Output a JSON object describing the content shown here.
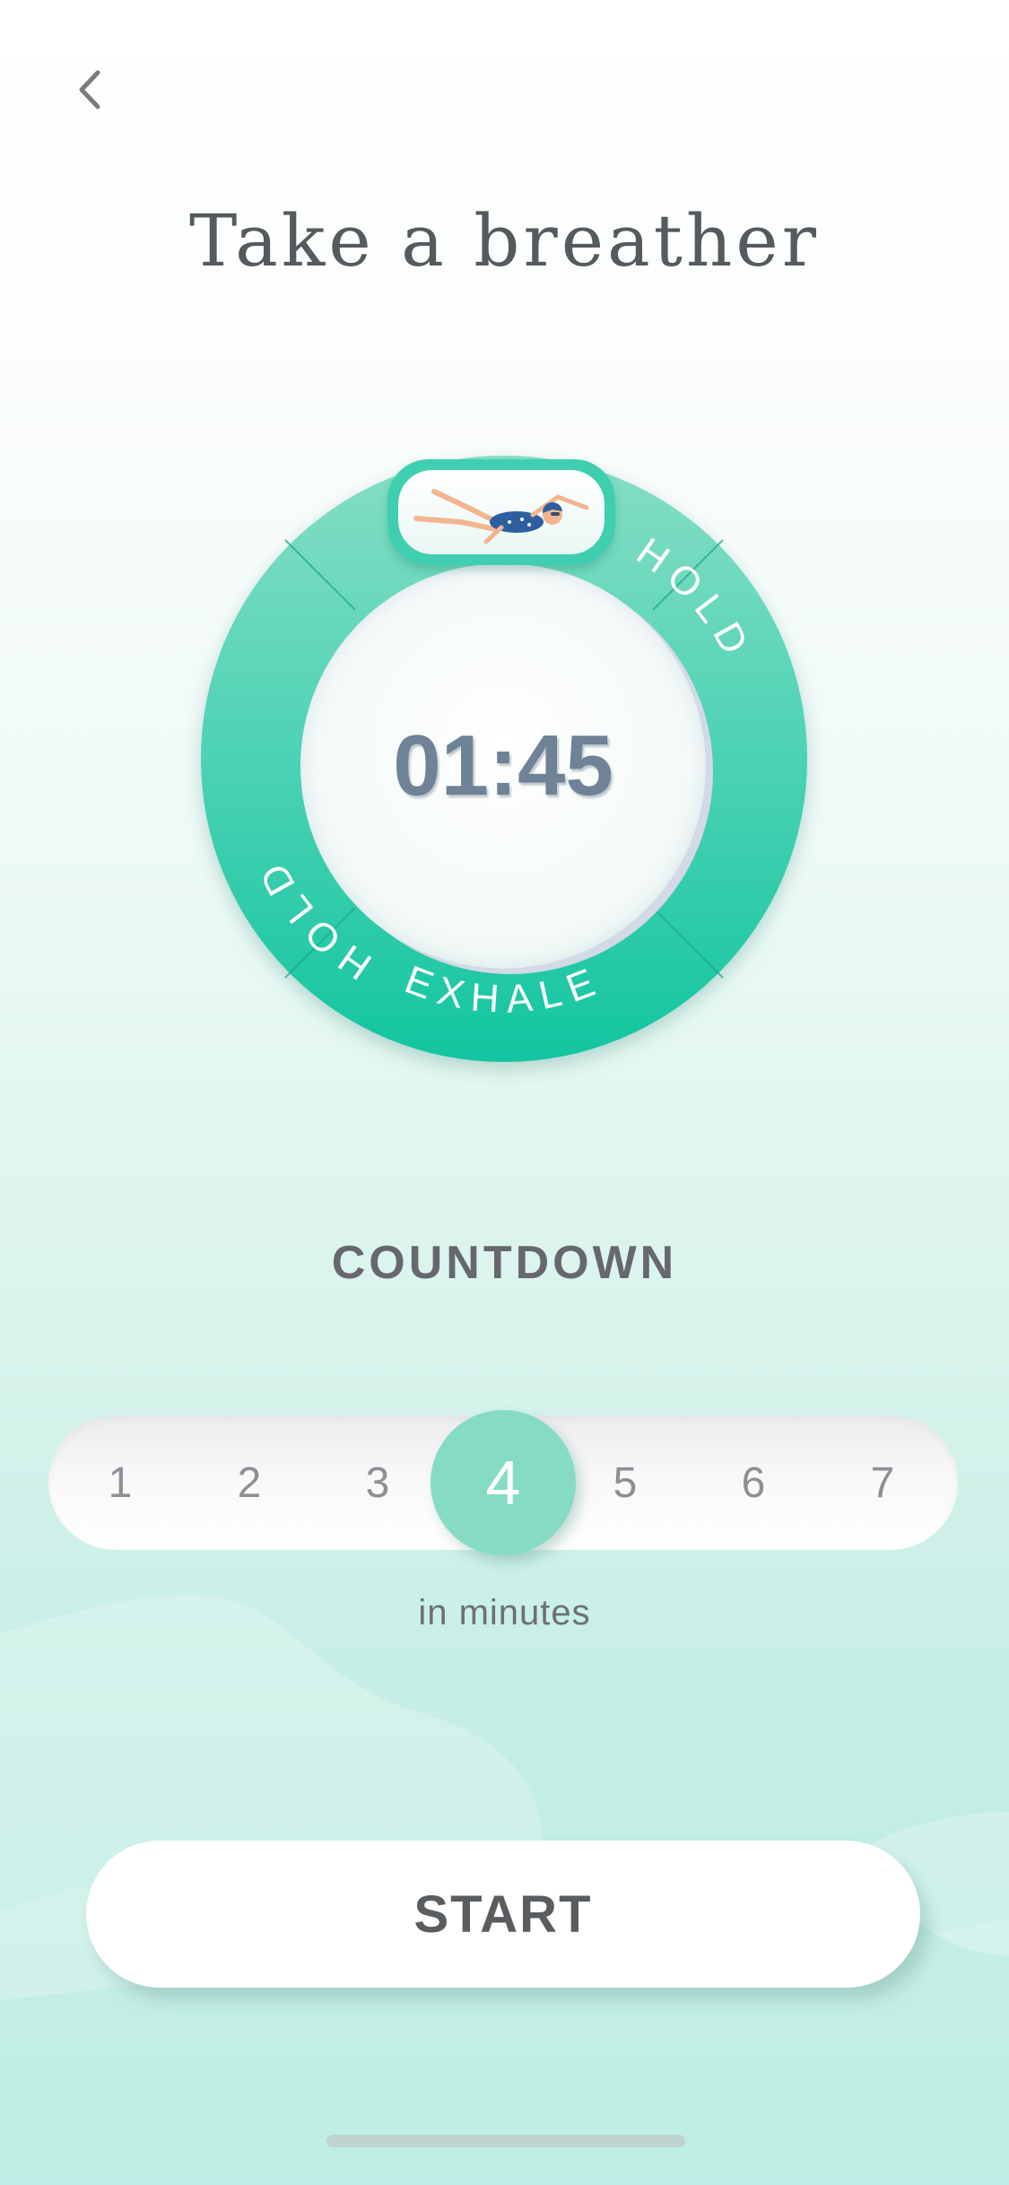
{
  "header": {
    "back_icon": "chevron-left-icon",
    "title": "Take a breather"
  },
  "breathing_ring": {
    "phases": {
      "left": "HOLD",
      "right": "HOLD",
      "bottom": "EXHALE"
    },
    "top_badge_icon": "swimmer-illustration",
    "timer": "01:45",
    "colors": {
      "ring_top": "#7fdcc0",
      "ring_bottom": "#16c6a2",
      "badge": "#3fcfb0"
    }
  },
  "countdown": {
    "label": "COUNTDOWN",
    "options": [
      "1",
      "2",
      "3",
      "4",
      "5",
      "6",
      "7"
    ],
    "selected": "4",
    "unit_label": "in minutes",
    "selected_color": "#86dcc3"
  },
  "start_button": {
    "label": "START"
  }
}
